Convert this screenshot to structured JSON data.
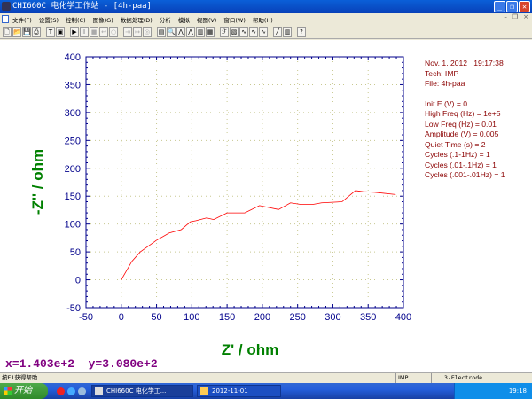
{
  "window": {
    "title": "CHI660C 电化学工作站 - [4h-paa]"
  },
  "menu": [
    "文件(F)",
    "设置(S)",
    "控制(C)",
    "图像(G)",
    "数据处理(D)",
    "分析",
    "模拟",
    "视图(V)",
    "窗口(W)",
    "帮助(H)"
  ],
  "toolbar": [
    "new",
    "open",
    "save",
    "print",
    "text",
    "graph-options",
    "run",
    "pause",
    "stop",
    "reverse",
    "zero",
    "tool1",
    "tool2",
    "tool3",
    "present-data",
    "zoom",
    "peak",
    "tool4",
    "tool5",
    "color",
    "fit",
    "tool6",
    "tool7",
    "tool8",
    "tool9",
    "tool10",
    "tool11",
    "help"
  ],
  "info": {
    "date": "Nov. 1, 2012",
    "time": "19:17:38",
    "tech": "Tech: IMP",
    "file": "File: 4h-paa",
    "params": [
      "Init E (V) = 0",
      "High Freq (Hz) = 1e+5",
      "Low Freq (Hz) = 0.01",
      "Amplitude (V) = 0.005",
      "Quiet Time (s) = 2",
      "Cycles (.1-1Hz) = 1",
      "Cycles (.01-.1Hz) = 1",
      "Cycles (.001-.01Hz) = 1"
    ]
  },
  "readout": {
    "x": "x=1.403e+2",
    "y": "y=3.080e+2"
  },
  "status": {
    "help": "按F1获得帮助",
    "tech": "IMP",
    "electrode": "3-Electrode"
  },
  "taskbar": {
    "start": "开始",
    "tasks": [
      "CHI660C 电化学工...",
      "2012-11-01"
    ],
    "clock": "19:18"
  },
  "chart_data": {
    "type": "line",
    "xlabel": "Z' / ohm",
    "ylabel": "-Z'' / ohm",
    "xlim": [
      -50,
      400
    ],
    "ylim": [
      -50,
      400
    ],
    "xticks": [
      -50,
      0,
      50,
      100,
      150,
      200,
      250,
      300,
      350,
      400
    ],
    "yticks": [
      -50,
      0,
      50,
      100,
      150,
      200,
      250,
      300,
      350,
      400
    ],
    "grid": true,
    "colors": {
      "line": "#ff0000",
      "axis": "#00008b",
      "label": "#008000",
      "grid": "#c8c890"
    },
    "x": [
      0,
      15,
      27,
      50,
      68,
      85,
      98,
      106,
      121,
      131,
      150,
      175,
      196,
      223,
      240,
      255,
      271,
      284,
      313,
      332,
      343,
      359,
      389
    ],
    "y": [
      0,
      33,
      50,
      71,
      84,
      90,
      104,
      106,
      111,
      108,
      120,
      120,
      133,
      126,
      138,
      135,
      135,
      138,
      140,
      160,
      158,
      157,
      153
    ]
  }
}
